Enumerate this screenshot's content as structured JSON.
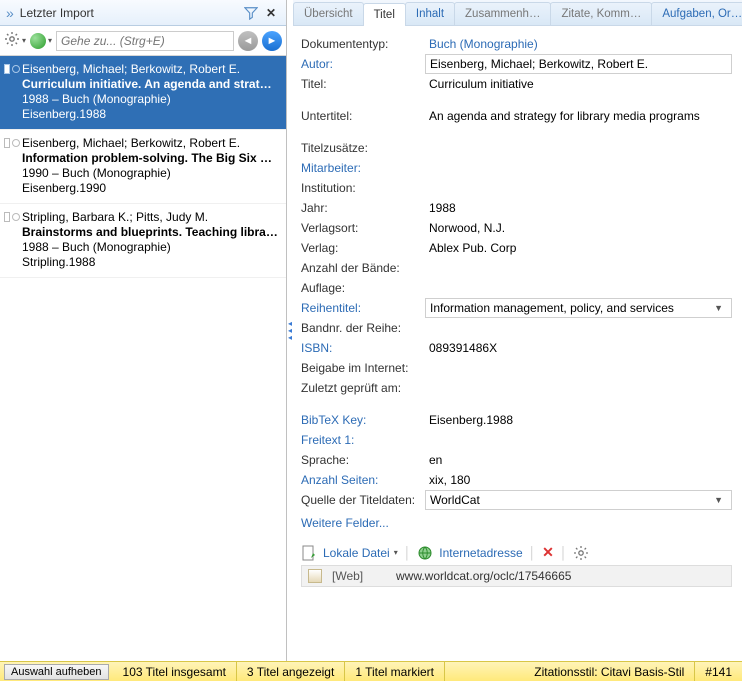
{
  "left": {
    "title": "Letzter Import",
    "search_placeholder": "Gehe zu... (Strg+E)",
    "items": [
      {
        "authors": "Eisenberg, Michael; Berkowitz, Robert E.",
        "title": "Curriculum initiative. An agenda and strategy",
        "year_type": "1988 – Buch (Monographie)",
        "key": "Eisenberg.1988",
        "selected": true
      },
      {
        "authors": "Eisenberg, Michael; Berkowitz, Robert E.",
        "title": "Information problem-solving. The Big Six Ski",
        "year_type": "1990 – Buch (Monographie)",
        "key": "Eisenberg.1990",
        "selected": false
      },
      {
        "authors": "Stripling, Barbara K.; Pitts, Judy M.",
        "title": "Brainstorms and blueprints. Teaching library r",
        "year_type": "1988 – Buch (Monographie)",
        "key": "Stripling.1988",
        "selected": false
      }
    ]
  },
  "tabs": [
    "Übersicht",
    "Titel",
    "Inhalt",
    "Zusammenh…",
    "Zitate, Komm…",
    "Aufgaben, Or…"
  ],
  "detail": {
    "doc_type_label": "Dokumententyp:",
    "doc_type": "Buch (Monographie)",
    "author_label": "Autor:",
    "author": "Eisenberg, Michael; Berkowitz, Robert E.",
    "title_label": "Titel:",
    "title": "Curriculum initiative",
    "subtitle_label": "Untertitel:",
    "subtitle": "An agenda and strategy for library media programs",
    "title_sup_label": "Titelzusätze:",
    "title_sup": "",
    "collab_label": "Mitarbeiter:",
    "collab": "",
    "inst_label": "Institution:",
    "inst": "",
    "year_label": "Jahr:",
    "year": "1988",
    "place_label": "Verlagsort:",
    "place": "Norwood, N.J.",
    "publisher_label": "Verlag:",
    "publisher": "Ablex Pub. Corp",
    "volumes_label": "Anzahl der Bände:",
    "volumes": "",
    "edition_label": "Auflage:",
    "edition": "",
    "series_label": "Reihentitel:",
    "series": "Information management, policy, and services",
    "series_no_label": "Bandnr. der Reihe:",
    "series_no": "",
    "isbn_label": "ISBN:",
    "isbn": "089391486X",
    "online_label": "Beigabe im Internet:",
    "online": "",
    "checked_label": "Zuletzt geprüft am:",
    "checked": "",
    "bibtex_label": "BibTeX Key:",
    "bibtex": "Eisenberg.1988",
    "free1_label": "Freitext 1:",
    "free1": "",
    "lang_label": "Sprache:",
    "lang": "en",
    "pages_label": "Anzahl Seiten:",
    "pages": "xix, 180",
    "source_label": "Quelle der Titeldaten:",
    "source": "WorldCat",
    "more_fields": "Weitere Felder...",
    "local_file": "Lokale Datei",
    "internet": "Internetadresse",
    "web_label": "[Web]",
    "url": "www.worldcat.org/oclc/17546665"
  },
  "status": {
    "deselect": "Auswahl aufheben",
    "total": "103 Titel insgesamt",
    "shown": "3 Titel angezeigt",
    "marked": "1 Titel markiert",
    "style": "Zitationsstil: Citavi Basis-Stil",
    "num": "#141"
  }
}
